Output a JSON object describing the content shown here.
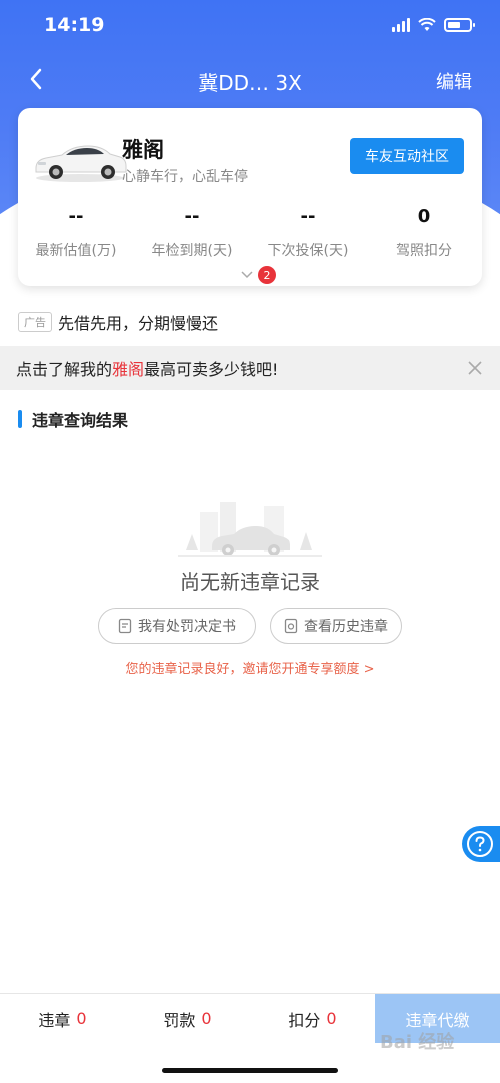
{
  "status_bar": {
    "time": "14:19"
  },
  "nav": {
    "title": "冀DD… 3X",
    "edit": "编辑"
  },
  "car": {
    "name": "雅阁",
    "slogan": "心静车行，心乱车停",
    "community_button": "车友互动社区",
    "stats": [
      {
        "value": "--",
        "label": "最新估值(万)"
      },
      {
        "value": "--",
        "label": "年检到期(天)"
      },
      {
        "value": "--",
        "label": "下次投保(天)"
      },
      {
        "value": "0",
        "label": "驾照扣分"
      }
    ],
    "badge_count": "2"
  },
  "ad": {
    "tag": "广告",
    "text": "先借先用，分期慢慢还"
  },
  "promo": {
    "prefix": "点击了解我的",
    "highlight": "雅阁",
    "suffix": "最高可卖多少钱吧!"
  },
  "section": {
    "title": "违章查询结果"
  },
  "empty": {
    "text": "尚无新违章记录",
    "btn_penalty": "我有处罚决定书",
    "btn_history": "查看历史违章",
    "invite": "您的违章记录良好，邀请您开通专享额度 >"
  },
  "bottom": {
    "violations_label": "违章",
    "violations_count": "0",
    "fines_label": "罚款",
    "fines_count": "0",
    "points_label": "扣分",
    "points_count": "0",
    "pay_button": "违章代缴"
  },
  "watermark": "Bai 经验",
  "colors": {
    "primary": "#1a8cf0",
    "header": "#4f7cf5",
    "alert": "#e8333a"
  }
}
